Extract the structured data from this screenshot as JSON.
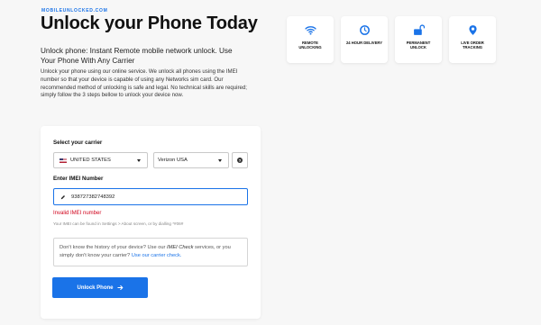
{
  "header": {
    "site_name": "MOBILEUNLOCKED.COM",
    "title": "Unlock your Phone Today",
    "subtitle": "Unlock phone: Instant Remote mobile network unlock. Use Your Phone With Any Carrier",
    "description": "Unlock your phone using our online service. We unlock all phones using the IMEI number so that your device is capable of using any Networks sim card. Our recommended method of unlocking is safe and legal. No technical skills are required; simply follow the 3 steps bellow to unlock your device now."
  },
  "features": [
    {
      "label": "REMOTE UNLOCKING",
      "icon": "wifi-icon"
    },
    {
      "label": "24 HOUR DELIVERY",
      "icon": "clock-icon"
    },
    {
      "label": "PERMANENT UNLOCK",
      "icon": "unlock-icon"
    },
    {
      "label": "LIVE ORDER TRACKING",
      "icon": "location-pin-icon"
    }
  ],
  "form": {
    "carrier_label": "Select your carrier",
    "country_value": "UNITED STATES",
    "carrier_value": "Verizon USA",
    "imei_label": "Enter IMEI Number",
    "imei_value": "938727382748392",
    "error": "Invalid IMEI number",
    "hint": "Your IMEI can be found in Settings > About screen, or by dialling *#06#",
    "info_prefix": "Don't know the history of your device? Use our ",
    "info_link1": "IMEI Check",
    "info_middle": " services, or you simply don't know your carrier? ",
    "info_link2": "Use our carrier check.",
    "button_label": "Unlock Phone",
    "help_symbol": "?"
  },
  "colors": {
    "accent": "#1a73e8",
    "error": "#d0021b"
  }
}
